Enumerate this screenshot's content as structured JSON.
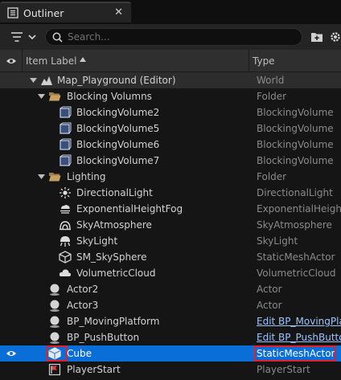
{
  "tab": {
    "title": "Outliner",
    "close": "✕"
  },
  "search": {
    "placeholder": "Search..."
  },
  "header": {
    "label": "Item Label",
    "type": "Type"
  },
  "rows": [
    {
      "label": "Map_Playground (Editor)",
      "type": "World"
    },
    {
      "label": "Blocking Volumns",
      "type": "Folder"
    },
    {
      "label": "BlockingVolume2",
      "type": "BlockingVolume"
    },
    {
      "label": "BlockingVolume5",
      "type": "BlockingVolume"
    },
    {
      "label": "BlockingVolume6",
      "type": "BlockingVolume"
    },
    {
      "label": "BlockingVolume7",
      "type": "BlockingVolume"
    },
    {
      "label": "Lighting",
      "type": "Folder"
    },
    {
      "label": "DirectionalLight",
      "type": "DirectionalLight"
    },
    {
      "label": "ExponentialHeightFog",
      "type": "ExponentialHeightFog"
    },
    {
      "label": "SkyAtmosphere",
      "type": "SkyAtmosphere"
    },
    {
      "label": "SkyLight",
      "type": "SkyLight"
    },
    {
      "label": "SM_SkySphere",
      "type": "StaticMeshActor"
    },
    {
      "label": "VolumetricCloud",
      "type": "VolumetricCloud"
    },
    {
      "label": "Actor2",
      "type": "Actor"
    },
    {
      "label": "Actor3",
      "type": "Actor"
    },
    {
      "label": "BP_MovingPlatform",
      "type": "Edit BP_MovingPlatform"
    },
    {
      "label": "BP_PushButton",
      "type": "Edit BP_PushButton"
    },
    {
      "label": "Cube",
      "type": "StaticMeshActor"
    },
    {
      "label": "PlayerStart",
      "type": "PlayerStart"
    }
  ],
  "icons": {
    "tab": "outliner-tab-icon",
    "filter": "filter-icon",
    "search": "search-icon",
    "add_folder": "add-folder-icon",
    "settings": "gear-icon",
    "visibility": "eye-icon"
  },
  "colors": {
    "selection": "#0a6ed8",
    "highlight_box": "#e0202a",
    "link": "#9cc3ff",
    "folder": "#c8a060"
  }
}
